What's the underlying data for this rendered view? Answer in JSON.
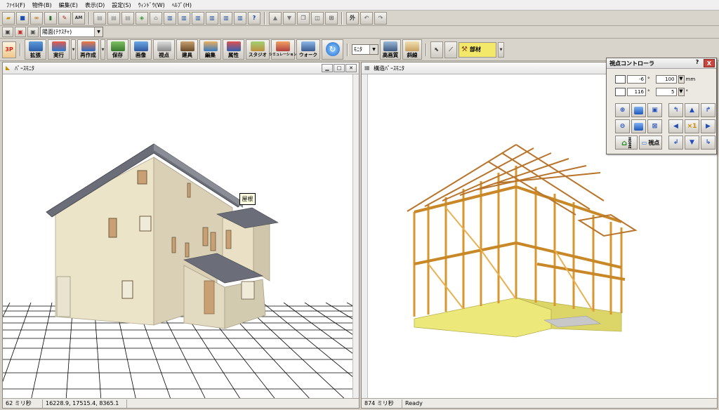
{
  "menu": [
    "ﾌｧｲﾙ(F)",
    "物件(B)",
    "編集(E)",
    "表示(D)",
    "設定(S)",
    "ｳｨﾝﾄﾞｳ(W)",
    "ﾍﾙﾌﾟ(H)"
  ],
  "toolbar1": {
    "am_label": "AM",
    "gaku_label": "外"
  },
  "toolbar2": {
    "view_mode": "陽面(ﾃｸｽﾁｬ)"
  },
  "toolbar3": {
    "three_p": "3P",
    "buttons": [
      "拡張",
      "実行",
      "再作成",
      "保存",
      "画像",
      "視点",
      "建具",
      "編集",
      "属性",
      "スタジオ",
      "シミュレーション",
      "ウォーク"
    ],
    "monitor_select": "ﾓﾆﾀ",
    "hq_label": "高画質",
    "slope_label": "斜線",
    "parts_label": "部材"
  },
  "left_pane": {
    "title": "ﾊﾟｰｽﾓﾆﾀ",
    "tooltip": "屋根",
    "status_time": "62 ミリ秒",
    "status_coords": "16228.9, 17515.4, 8365.1"
  },
  "right_pane": {
    "title": "構造ﾊﾟｰｽﾓﾆﾀ",
    "status_time": "874 ミリ秒",
    "status_state": "Ready"
  },
  "viewpoint": {
    "title": "視点コントローラ",
    "help": "?",
    "close": "X",
    "angle1": "-6",
    "angle2": "116",
    "degree_unit": "°",
    "step_distance": "100",
    "step_unit": "mm",
    "step_angle": "5",
    "zoom_x1": "×1",
    "viewpoint_btn": "視点",
    "home_label": "HOME"
  },
  "colors": {
    "wall": "#e9e0c6",
    "roof": "#6b6e78",
    "timber": "#e3a73d",
    "foundation": "#ece97a"
  }
}
